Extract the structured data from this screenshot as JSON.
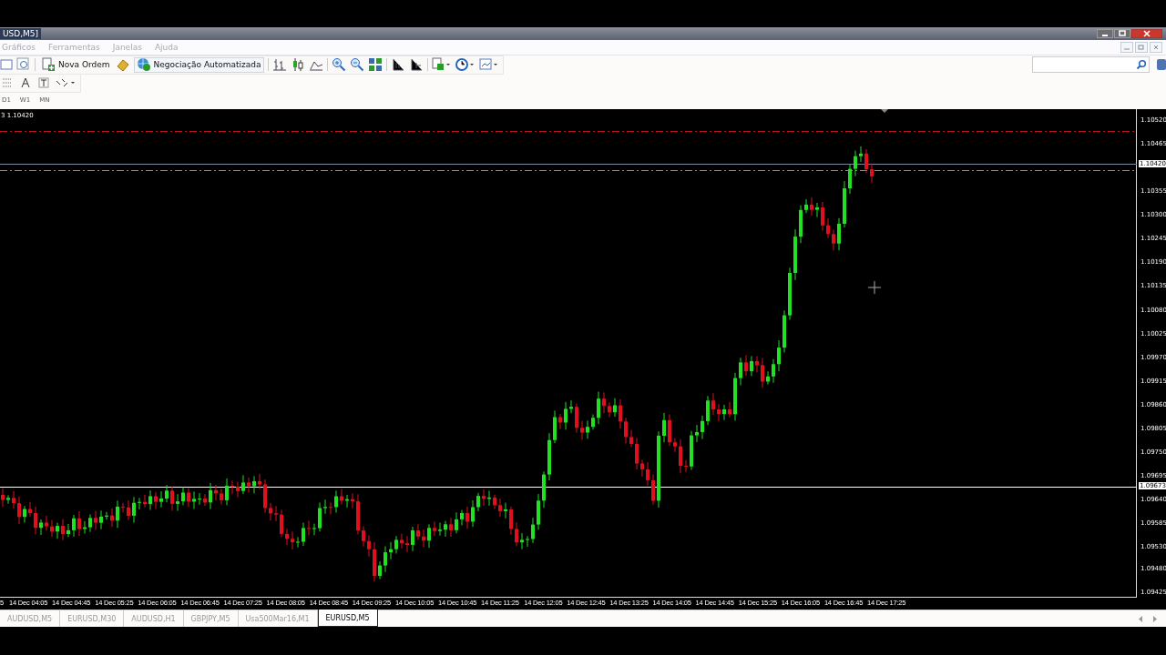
{
  "window": {
    "title": "USD,M5]"
  },
  "menu": [
    "Gráficos",
    "Ferramentas",
    "Janelas",
    "Ajuda"
  ],
  "toolbar": {
    "buttons": [
      {
        "kind": "new-order",
        "label": "Nova Ordem"
      },
      {
        "kind": "auto-trading",
        "label": "Negociação Automatizada"
      }
    ]
  },
  "timeframes": [
    "D1",
    "W1",
    "MN"
  ],
  "chart": {
    "info": "3 1.10420",
    "price_ticks": [
      "1.10520",
      "1.10465",
      "1.10355",
      "1.10300",
      "1.10245",
      "1.10190",
      "1.10135",
      "1.10080",
      "1.10025",
      "1.09970",
      "1.09915",
      "1.09860",
      "1.09805",
      "1.09750",
      "1.09695",
      "1.09640",
      "1.09585",
      "1.09530",
      "1.09480",
      "1.09425"
    ],
    "price_markers": [
      "1.10420",
      "1.09673"
    ],
    "time_labels": [
      "5",
      "14 Dec 04:05",
      "14 Dec 04:45",
      "14 Dec 05:25",
      "14 Dec 06:05",
      "14 Dec 06:45",
      "14 Dec 07:25",
      "14 Dec 08:05",
      "14 Dec 08:45",
      "14 Dec 09:25",
      "14 Dec 10:05",
      "14 Dec 10:45",
      "14 Dec 11:25",
      "14 Dec 12:05",
      "14 Dec 12:45",
      "14 Dec 13:25",
      "14 Dec 14:05",
      "14 Dec 14:45",
      "14 Dec 15:25",
      "14 Dec 16:05",
      "14 Dec 16:45",
      "14 Dec 17:25"
    ]
  },
  "tabs": [
    {
      "label": "AUDUSD,M5",
      "selected": false
    },
    {
      "label": "EURUSD,M30",
      "selected": false
    },
    {
      "label": "AUDUSD,H1",
      "selected": false
    },
    {
      "label": "GBPJPY,M5",
      "selected": false
    },
    {
      "label": "Usa500Mar16,M1",
      "selected": false
    },
    {
      "label": "EURUSD,M5",
      "selected": true
    }
  ]
}
